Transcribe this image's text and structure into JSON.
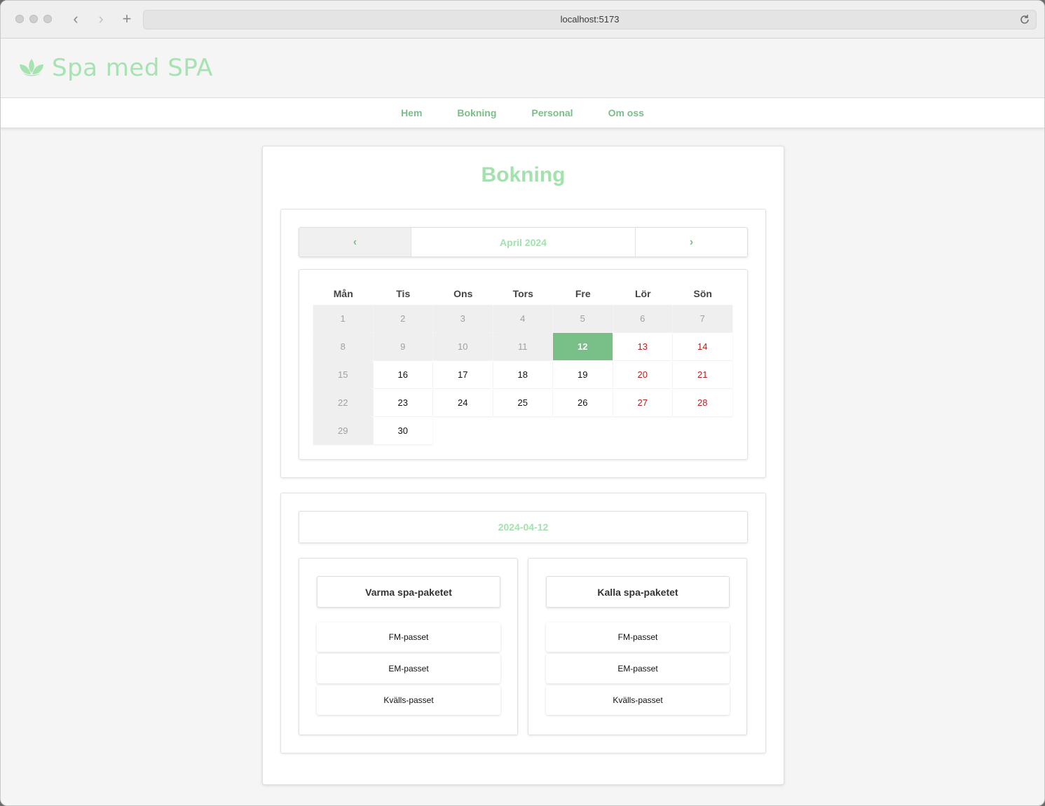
{
  "browser": {
    "url": "localhost:5173"
  },
  "site": {
    "logo_text": "Spa med SPA",
    "nav": [
      "Hem",
      "Bokning",
      "Personal",
      "Om oss"
    ]
  },
  "page": {
    "title": "Bokning"
  },
  "calendar": {
    "prev_label": "‹",
    "month_label": "April 2024",
    "next_label": "›",
    "weekdays": [
      "Mån",
      "Tis",
      "Ons",
      "Tors",
      "Fre",
      "Lör",
      "Sön"
    ],
    "days": [
      {
        "n": "1",
        "state": "past"
      },
      {
        "n": "2",
        "state": "past"
      },
      {
        "n": "3",
        "state": "past"
      },
      {
        "n": "4",
        "state": "past"
      },
      {
        "n": "5",
        "state": "past"
      },
      {
        "n": "6",
        "state": "past"
      },
      {
        "n": "7",
        "state": "past"
      },
      {
        "n": "8",
        "state": "past"
      },
      {
        "n": "9",
        "state": "past"
      },
      {
        "n": "10",
        "state": "past"
      },
      {
        "n": "11",
        "state": "past"
      },
      {
        "n": "12",
        "state": "selected"
      },
      {
        "n": "13",
        "state": "weekend"
      },
      {
        "n": "14",
        "state": "weekend"
      },
      {
        "n": "15",
        "state": "past"
      },
      {
        "n": "16",
        "state": "normal"
      },
      {
        "n": "17",
        "state": "normal"
      },
      {
        "n": "18",
        "state": "normal"
      },
      {
        "n": "19",
        "state": "normal"
      },
      {
        "n": "20",
        "state": "weekend"
      },
      {
        "n": "21",
        "state": "weekend"
      },
      {
        "n": "22",
        "state": "past"
      },
      {
        "n": "23",
        "state": "normal"
      },
      {
        "n": "24",
        "state": "normal"
      },
      {
        "n": "25",
        "state": "normal"
      },
      {
        "n": "26",
        "state": "normal"
      },
      {
        "n": "27",
        "state": "weekend"
      },
      {
        "n": "28",
        "state": "weekend"
      },
      {
        "n": "29",
        "state": "past"
      },
      {
        "n": "30",
        "state": "normal"
      }
    ]
  },
  "booking": {
    "selected_date": "2024-04-12",
    "packages": [
      {
        "title": "Varma spa-paketet",
        "slots": [
          "FM-passet",
          "EM-passet",
          "Kvälls-passet"
        ]
      },
      {
        "title": "Kalla spa-paketet",
        "slots": [
          "FM-passet",
          "EM-passet",
          "Kvälls-passet"
        ]
      }
    ]
  },
  "colors": {
    "accent_green": "#79bf88",
    "light_green": "#a3e2ad",
    "weekend_red": "#b81e1e"
  }
}
